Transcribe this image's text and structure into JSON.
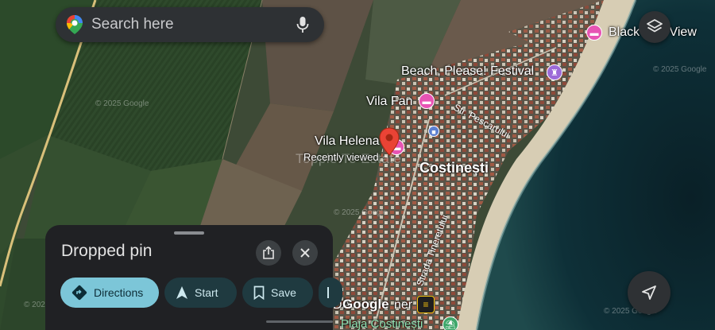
{
  "search": {
    "placeholder": "Search here",
    "logo_icon": "google-maps-pin-icon",
    "mic_icon": "microphone-icon"
  },
  "map": {
    "labels": {
      "black_sea_view": "Black Sea View",
      "beach_please": "Beach, Please! Festival",
      "vila_fan": "Vila Fan",
      "vila_helena": "Vila Helena",
      "recently_viewed": "Recently viewed",
      "costinesti": "Costinești",
      "plaja": "Plaja Costinești",
      "da_fragment": "DA",
      "ner_fragment": "ner",
      "street_pescarului": "Str. Pescarului",
      "strada_tineretului": "Strada Tineretului",
      "ghost_text": "Topple Te Estate"
    },
    "watermarks": [
      "© 2025 Google",
      "© 2025 Google",
      "© 2025 Google",
      "© 2025 Google",
      "© 2025 Google"
    ],
    "attribution": "Google",
    "colors": {
      "pin": "#ea4335",
      "hotel_poi": "#e754b4",
      "festival_poi": "#9c6ad8",
      "sea": "#0b2a30"
    }
  },
  "controls": {
    "layers_icon": "layers-icon",
    "navigate_icon": "navigation-arrow-icon"
  },
  "sheet": {
    "title": "Dropped pin",
    "share_icon": "share-icon",
    "close_icon": "close-icon",
    "actions": {
      "directions": "Directions",
      "start": "Start",
      "save": "Save"
    },
    "accent_color": "#7cc6d8"
  }
}
